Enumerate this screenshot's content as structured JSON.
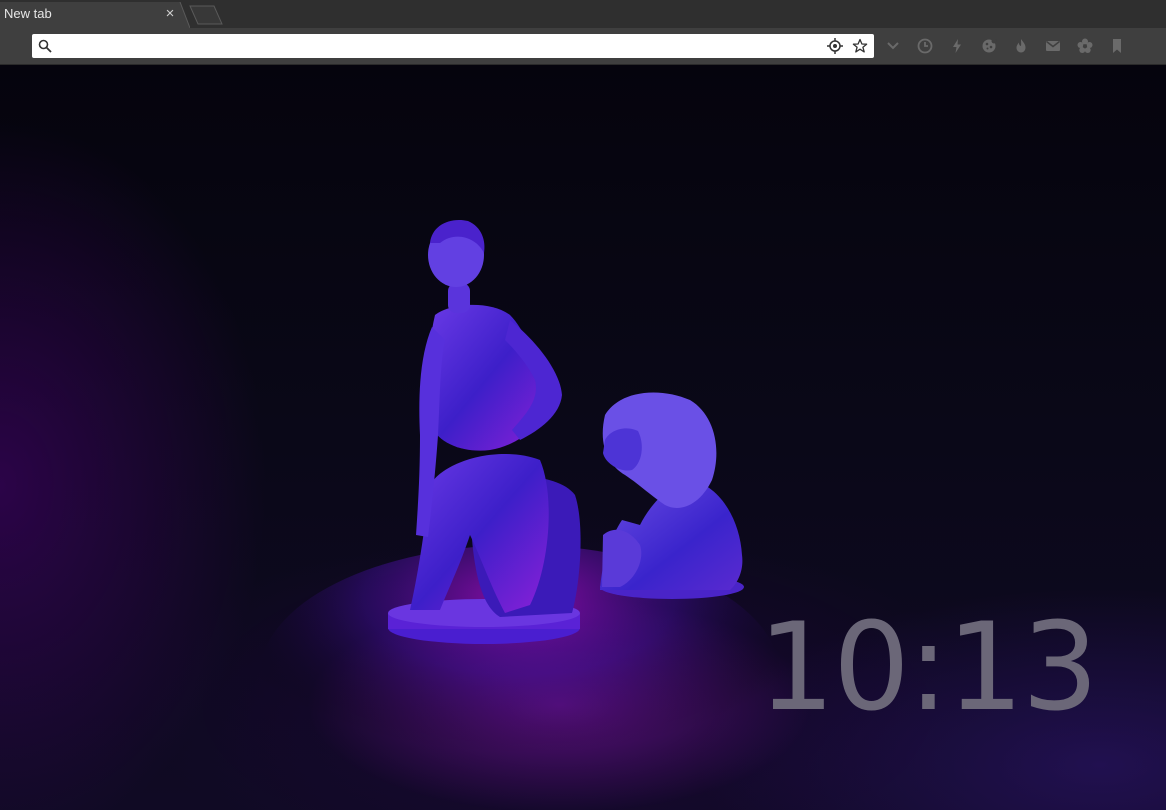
{
  "tabs": [
    {
      "title": "New tab",
      "active": true
    }
  ],
  "omnibox": {
    "value": "",
    "placeholder": ""
  },
  "toolbar_icons": [
    "chevron-down-icon",
    "clock-icon",
    "lightning-icon",
    "cookie-icon",
    "flame-icon",
    "mail-icon",
    "gear-flower-icon",
    "bookmark-icon"
  ],
  "clock": {
    "time": "10:13"
  },
  "colors": {
    "tabstrip": "#2f2f2f",
    "toolbar": "#3f3f3f",
    "clock_text": "#6b6778",
    "statue_purple": "#5a28d8",
    "reflection_magenta": "#b018d8"
  }
}
